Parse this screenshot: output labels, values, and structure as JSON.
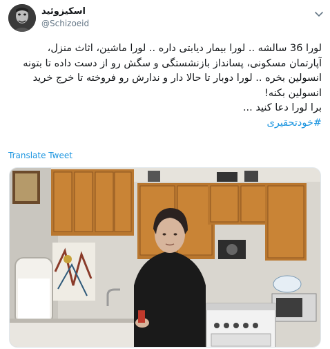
{
  "author": {
    "display_name": "اسکیزوئید",
    "handle": "@Schizoeid"
  },
  "tweet": {
    "lines": [
      "لورا 36 سالشه .. لورا بیمار دیابتی داره .. لورا ماشین، اثاث منزل،",
      "آپارتمان مسکونی، پسانداز بازنشستگی و سگش رو از دست داده تا بتونه",
      "انسولین بخره .. لورا دوبار تا حالا دار و ندارش رو فروخته تا خرج خرید",
      "انسولین بکنه!",
      "برا لورا دعا کنید ..."
    ],
    "hashtag": "#خودتحقیری"
  },
  "translate_label": "Translate Tweet",
  "icons": {
    "menu": "chevron-down-icon",
    "avatar": "user-avatar"
  },
  "colors": {
    "link": "#1b95e0",
    "text": "#14171a",
    "muted": "#657786"
  }
}
